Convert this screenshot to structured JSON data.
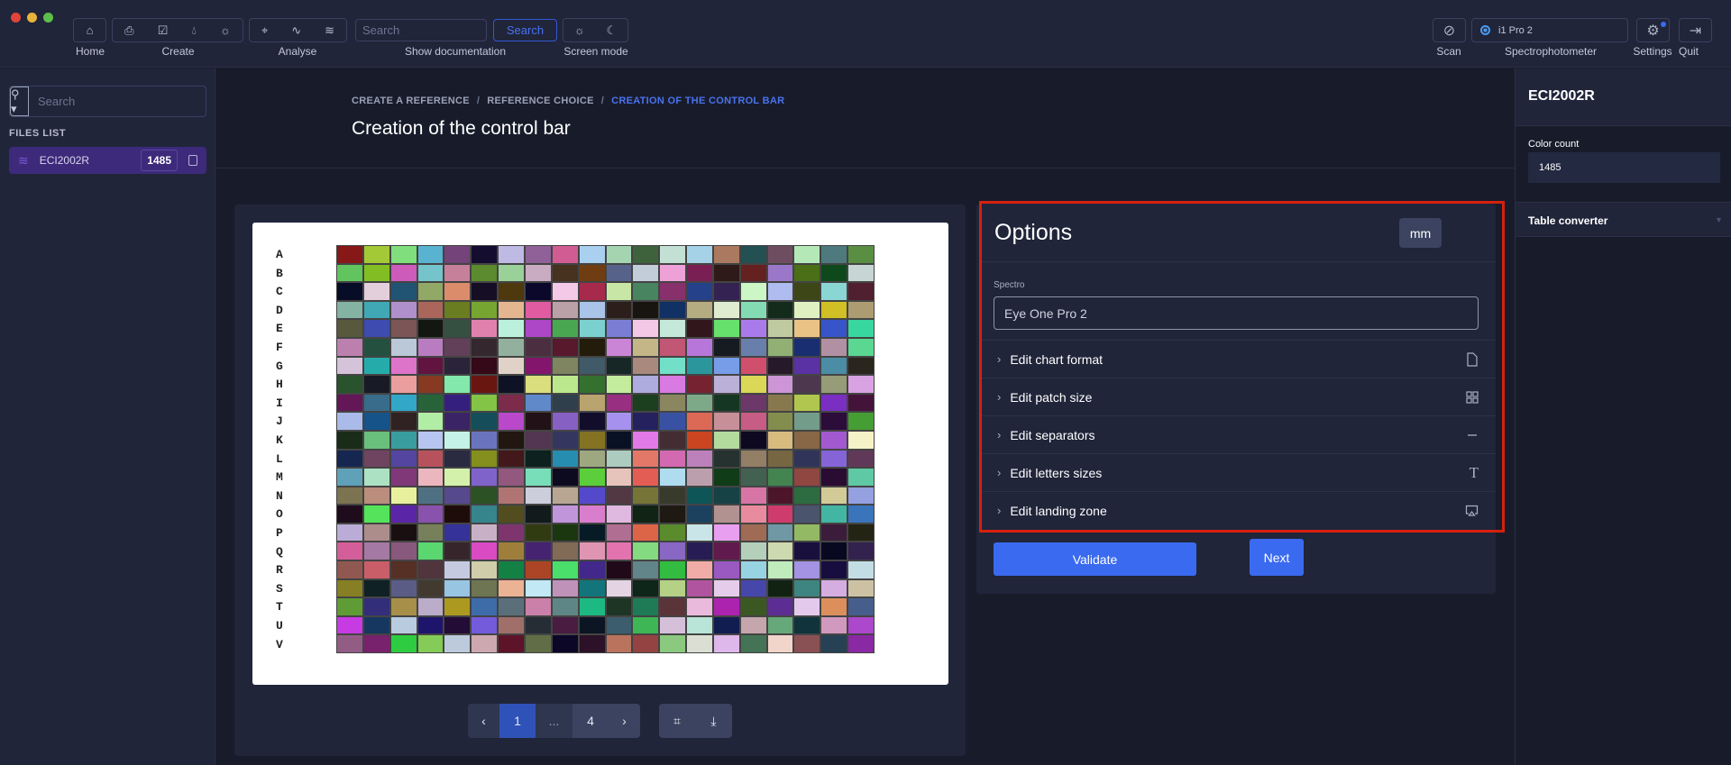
{
  "toolbar": {
    "home_label": "Home",
    "create_label": "Create",
    "analyse_label": "Analyse",
    "search_placeholder": "Search",
    "search_button": "Search",
    "doc_label": "Show documentation",
    "screen_mode_label": "Screen mode",
    "scan_label": "Scan",
    "spectro_value": "i1 Pro 2",
    "spectro_label": "Spectrophotometer",
    "settings_label": "Settings",
    "quit_label": "Quit"
  },
  "sidebar": {
    "search_placeholder": "Search",
    "files_title": "FILES LIST",
    "files": [
      {
        "name": "ECI2002R",
        "count": "1485"
      }
    ]
  },
  "breadcrumb": [
    "CREATE A REFERENCE",
    "REFERENCE CHOICE",
    "CREATION OF THE CONTROL BAR"
  ],
  "page_title": "Creation of the control bar",
  "chart": {
    "rows": [
      "A",
      "B",
      "C",
      "D",
      "E",
      "F",
      "G",
      "H",
      "I",
      "J",
      "K",
      "L",
      "M",
      "N",
      "O",
      "P",
      "Q",
      "R",
      "S",
      "T",
      "U",
      "V"
    ],
    "columns": 20
  },
  "pagination": {
    "current": "1",
    "ellipsis": "...",
    "last": "4"
  },
  "options": {
    "title": "Options",
    "unit": "mm",
    "spectro_label": "Spectro",
    "spectro_value": "Eye One Pro 2",
    "sections": [
      {
        "label": "Edit chart format",
        "icon": "file-icon"
      },
      {
        "label": "Edit patch size",
        "icon": "grid-icon"
      },
      {
        "label": "Edit separators",
        "icon": "minus-icon"
      },
      {
        "label": "Edit letters sizes",
        "icon": "text-icon"
      },
      {
        "label": "Edit landing zone",
        "icon": "airplay-icon"
      }
    ],
    "validate": "Validate",
    "next": "Next"
  },
  "right_panel": {
    "title": "ECI2002R",
    "color_count_label": "Color count",
    "color_count": "1485",
    "table_converter": "Table converter"
  },
  "colors": {
    "accent": "#3a6af0",
    "highlight": "#d6200e",
    "file_active": "#3d2a7a"
  }
}
